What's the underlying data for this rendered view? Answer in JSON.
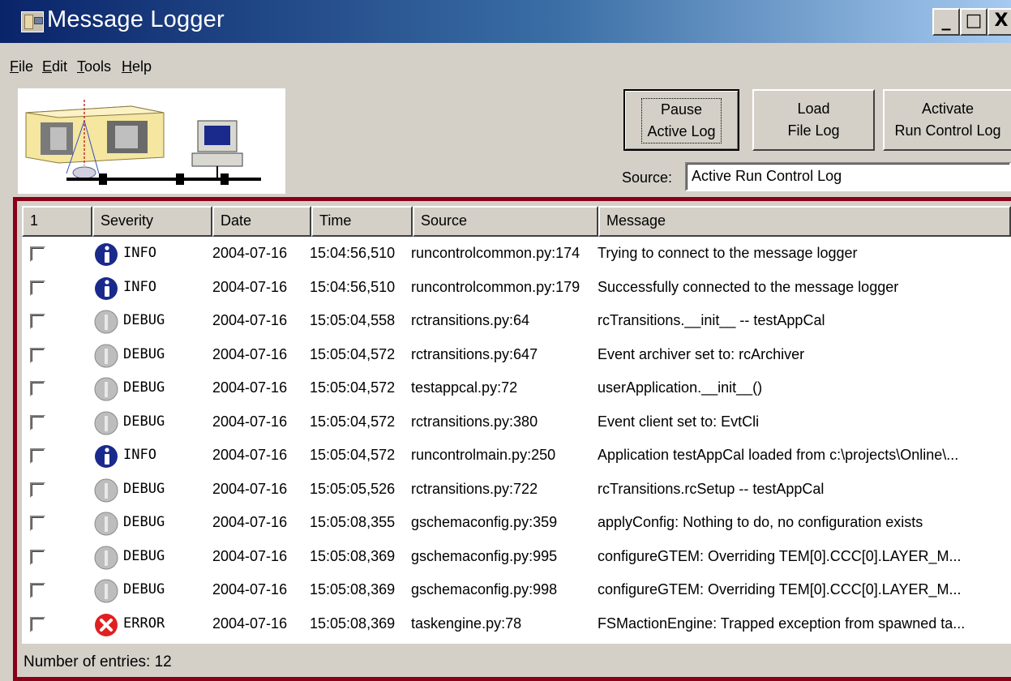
{
  "window": {
    "title": "Message Logger",
    "controls": {
      "minimize": "_",
      "maximize": "□",
      "close": "X"
    }
  },
  "menu": [
    {
      "label": "File",
      "accel": "F",
      "rest": "ile"
    },
    {
      "label": "Edit",
      "accel": "E",
      "rest": "dit"
    },
    {
      "label": "Tools",
      "accel": "T",
      "rest": "ools"
    },
    {
      "label": "Help",
      "accel": "H",
      "rest": "elp"
    }
  ],
  "toolbar": {
    "pause": {
      "line1": "Pause",
      "line2": "Active Log"
    },
    "load": {
      "line1": "Load",
      "line2": "File Log"
    },
    "activate": {
      "line1": "Activate",
      "line2": "Run Control Log"
    },
    "source_label": "Source:",
    "source_value": "Active Run Control Log"
  },
  "log": {
    "columns": [
      "1",
      "Severity",
      "Date",
      "Time",
      "Source",
      "Message"
    ],
    "rows": [
      {
        "severity": "INFO",
        "date": "2004-07-16",
        "time": "15:04:56,510",
        "source": "runcontrolcommon.py:174",
        "message": "Trying to connect to the message logger"
      },
      {
        "severity": "INFO",
        "date": "2004-07-16",
        "time": "15:04:56,510",
        "source": "runcontrolcommon.py:179",
        "message": "Successfully connected to the message logger"
      },
      {
        "severity": "DEBUG",
        "date": "2004-07-16",
        "time": "15:05:04,558",
        "source": "rctransitions.py:64",
        "message": "rcTransitions.__init__ -- testAppCal"
      },
      {
        "severity": "DEBUG",
        "date": "2004-07-16",
        "time": "15:05:04,572",
        "source": "rctransitions.py:647",
        "message": "Event archiver set to: rcArchiver"
      },
      {
        "severity": "DEBUG",
        "date": "2004-07-16",
        "time": "15:05:04,572",
        "source": "testappcal.py:72",
        "message": "userApplication.__init__()"
      },
      {
        "severity": "DEBUG",
        "date": "2004-07-16",
        "time": "15:05:04,572",
        "source": "rctransitions.py:380",
        "message": "Event client set to: EvtCli"
      },
      {
        "severity": "INFO",
        "date": "2004-07-16",
        "time": "15:05:04,572",
        "source": "runcontrolmain.py:250",
        "message": "Application testAppCal loaded from c:\\projects\\Online\\..."
      },
      {
        "severity": "DEBUG",
        "date": "2004-07-16",
        "time": "15:05:05,526",
        "source": "rctransitions.py:722",
        "message": "rcTransitions.rcSetup -- testAppCal"
      },
      {
        "severity": "DEBUG",
        "date": "2004-07-16",
        "time": "15:05:08,355",
        "source": "gschemaconfig.py:359",
        "message": "applyConfig: Nothing to do, no configuration exists"
      },
      {
        "severity": "DEBUG",
        "date": "2004-07-16",
        "time": "15:05:08,369",
        "source": "gschemaconfig.py:995",
        "message": "configureGTEM: Overriding TEM[0].CCC[0].LAYER_M..."
      },
      {
        "severity": "DEBUG",
        "date": "2004-07-16",
        "time": "15:05:08,369",
        "source": "gschemaconfig.py:998",
        "message": "configureGTEM: Overriding TEM[0].CCC[0].LAYER_M..."
      },
      {
        "severity": "ERROR",
        "date": "2004-07-16",
        "time": "15:05:08,369",
        "source": "taskengine.py:78",
        "message": "FSMactionEngine: Trapped exception from spawned ta..."
      }
    ]
  },
  "status": {
    "text": "Number of entries: 12"
  },
  "colors": {
    "frame": "#8b0019",
    "info": "#1a2a8c",
    "debug": "#b8b8b8",
    "error": "#e02020"
  }
}
